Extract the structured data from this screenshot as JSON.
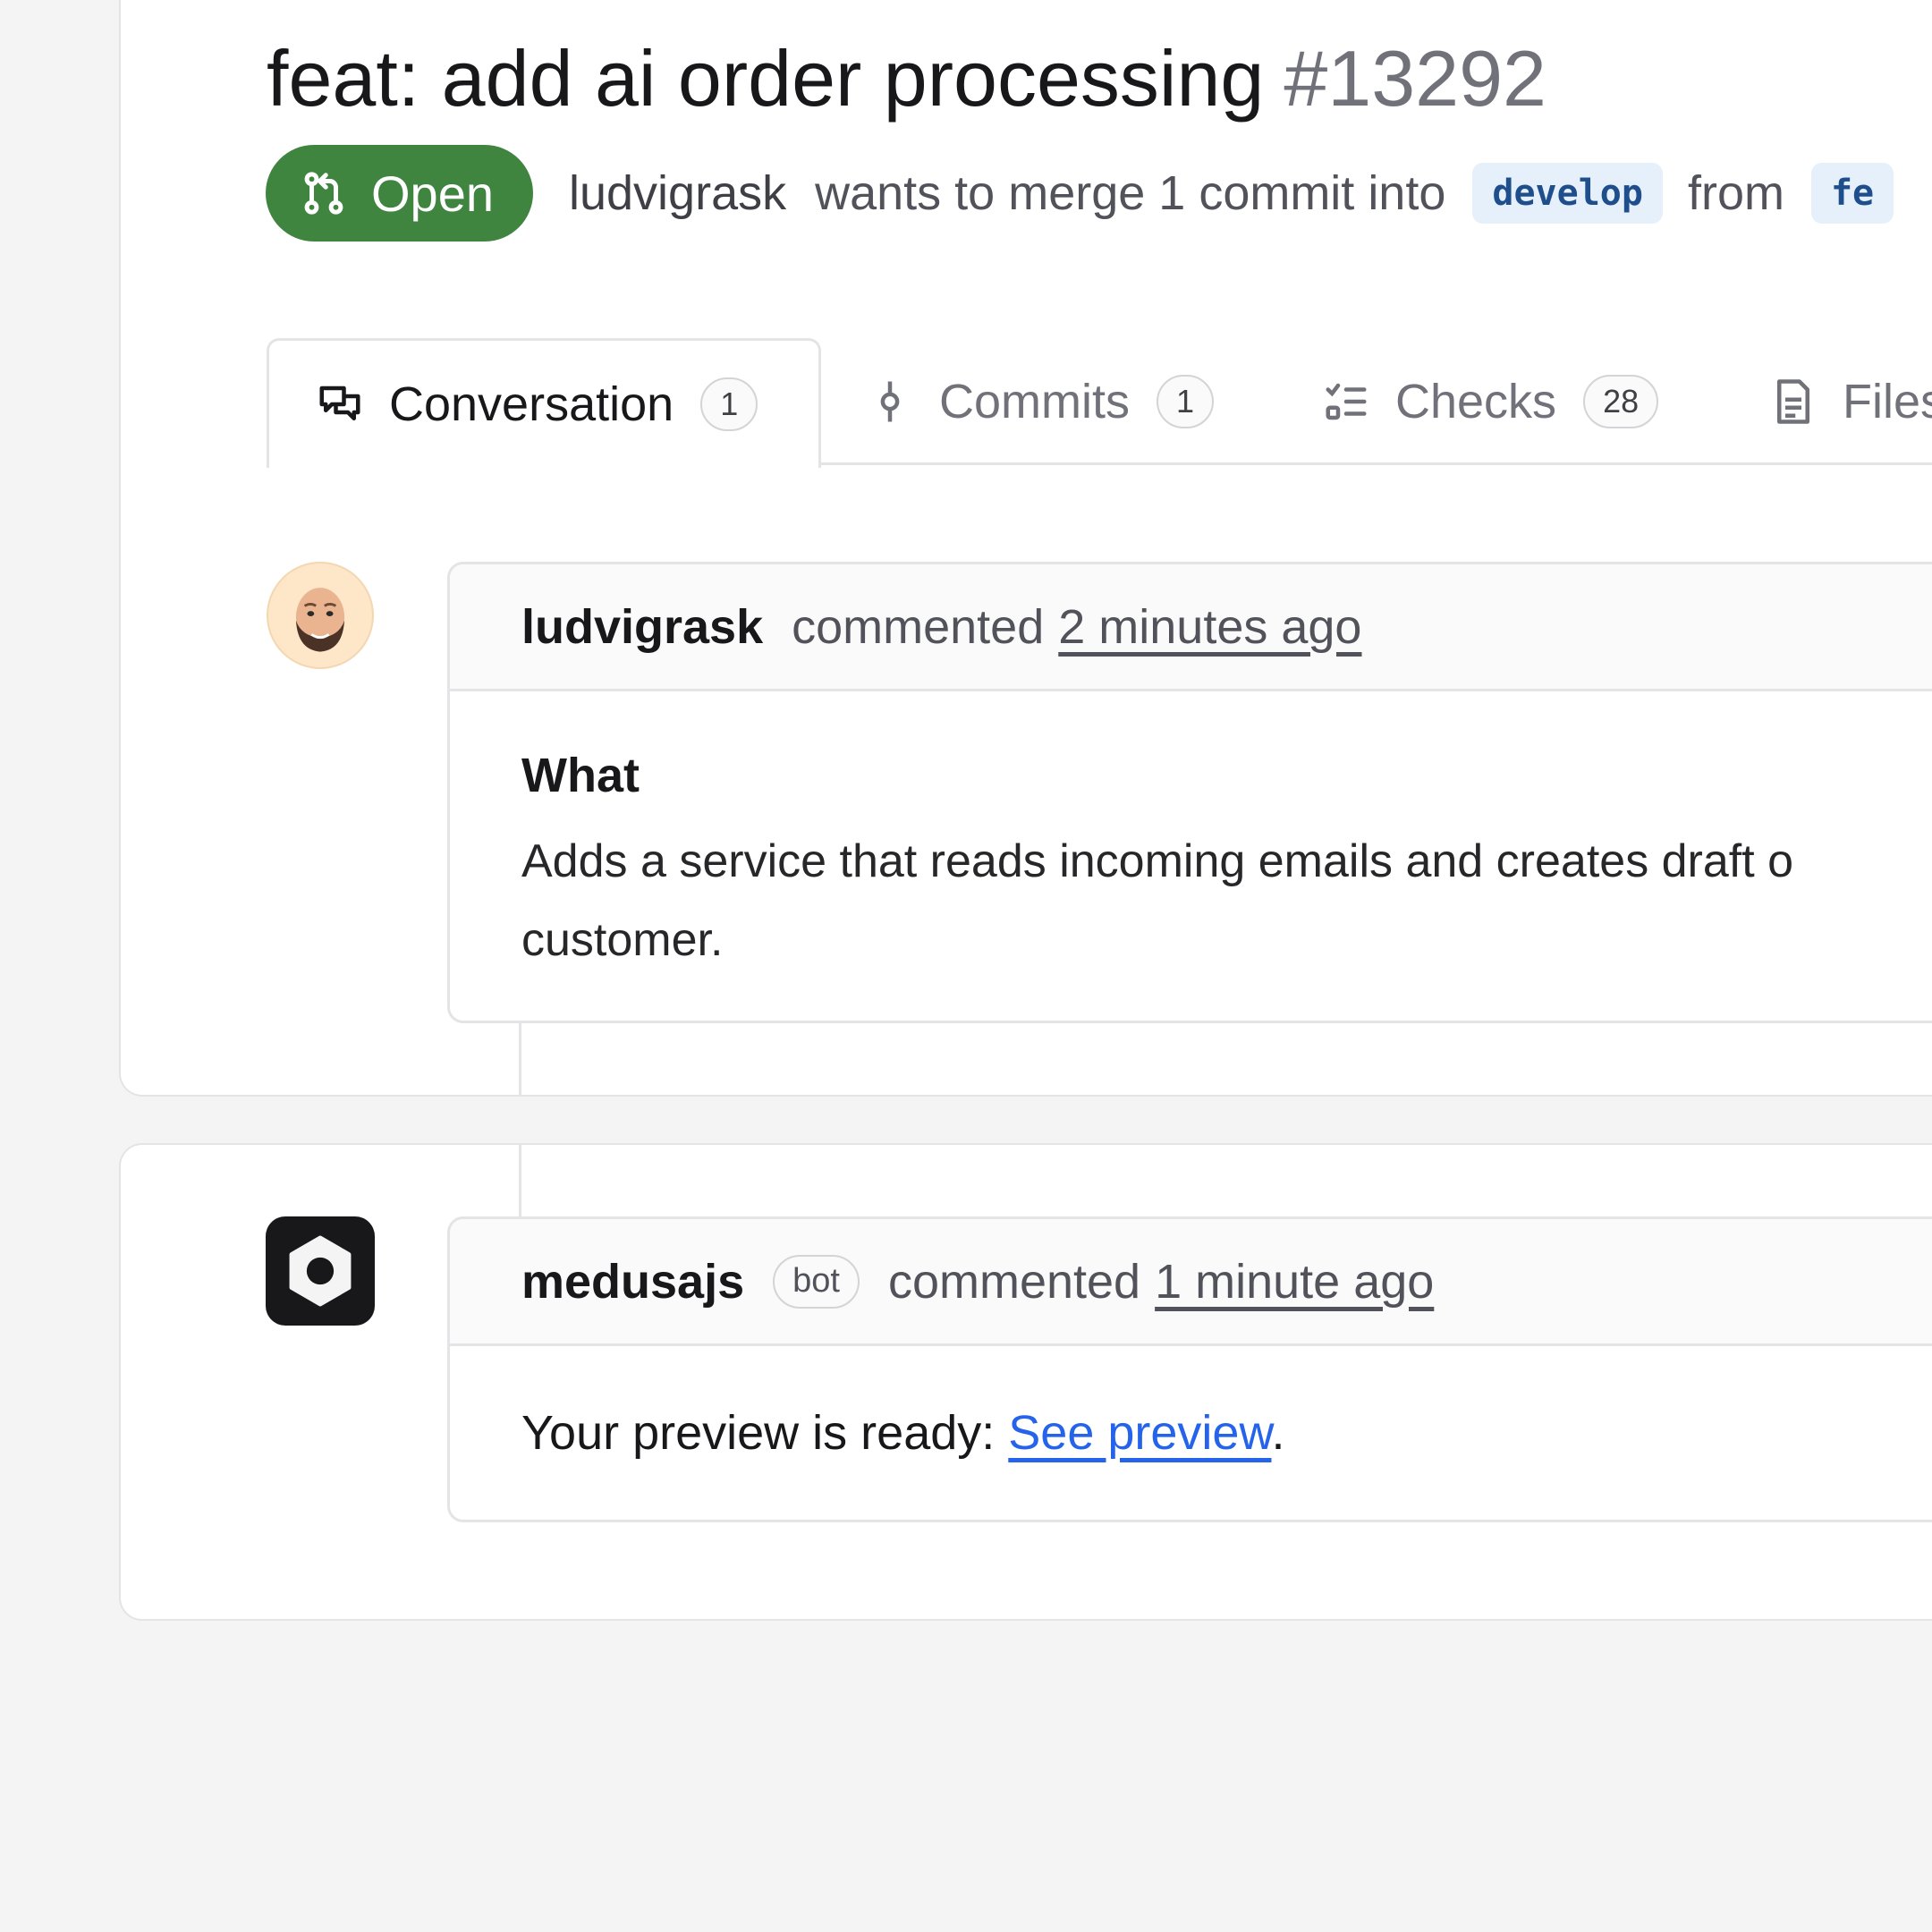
{
  "pull_request": {
    "title": "feat: add ai order processing",
    "number": "#13292",
    "status": "Open",
    "author": "ludvigrask",
    "merge_text": "wants to merge 1 commit into",
    "base_branch": "develop",
    "from_text": "from",
    "head_branch_fragment": "fe"
  },
  "tabs": [
    {
      "label": "Conversation",
      "count": "1",
      "icon": "comment-discussion-icon"
    },
    {
      "label": "Commits",
      "count": "1",
      "icon": "git-commit-icon"
    },
    {
      "label": "Checks",
      "count": "28",
      "icon": "checklist-icon"
    },
    {
      "label": "Files",
      "icon": "file-icon"
    }
  ],
  "comments": [
    {
      "author": "ludvigrask",
      "action": "commented",
      "time": "2 minutes ago",
      "heading": "What",
      "body": "Adds a service that reads incoming emails and creates draft o customer.",
      "body_line1": "Adds a service that reads incoming emails and creates draft o",
      "body_line2": "customer."
    },
    {
      "author": "medusajs",
      "badge": "bot",
      "action": "commented",
      "time": "1 minute ago",
      "body_prefix": "Your preview is ready: ",
      "link_text": "See preview",
      "body_suffix": "."
    }
  ],
  "colors": {
    "open_green": "#3f8540",
    "link_blue": "#2563eb",
    "branch_bg": "#e6f0fb",
    "branch_text": "#1e4e8c"
  }
}
